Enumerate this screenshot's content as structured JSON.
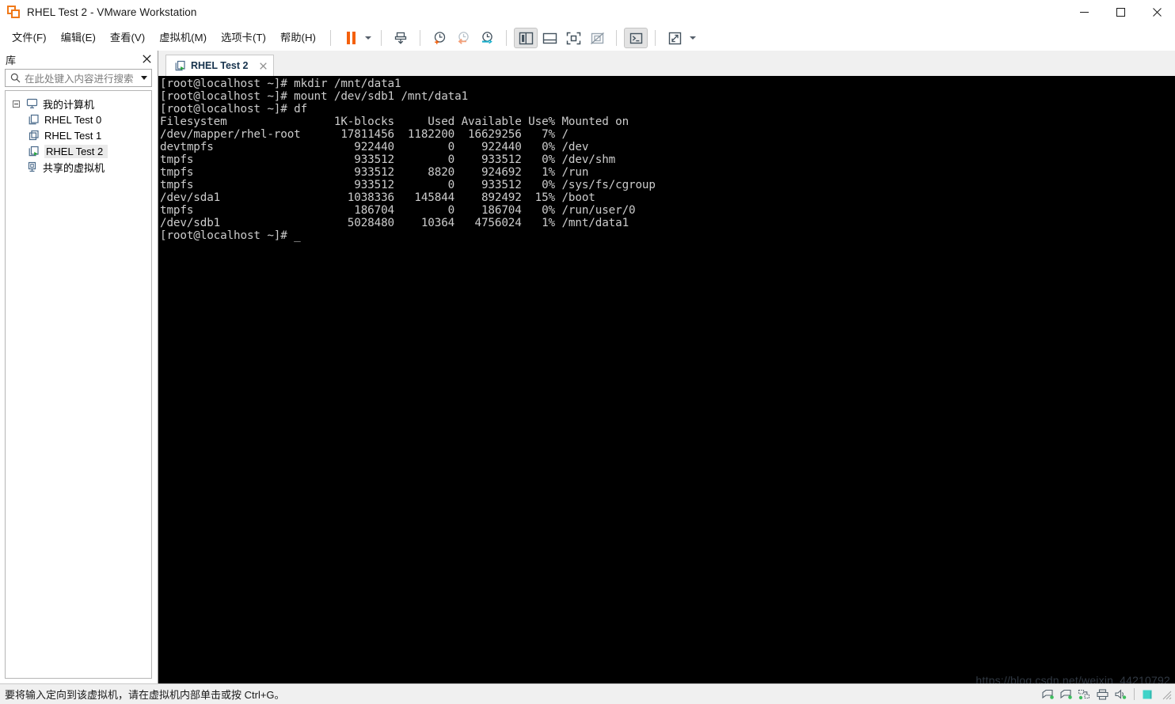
{
  "window": {
    "title": "RHEL Test 2 - VMware Workstation",
    "icon": "vmware-logo-icon",
    "controls": {
      "minimize": "minimize-button",
      "maximize": "maximize-button",
      "close": "close-button"
    }
  },
  "menubar": {
    "items": [
      {
        "label": "文件(F)",
        "name": "menu-file"
      },
      {
        "label": "编辑(E)",
        "name": "menu-edit"
      },
      {
        "label": "查看(V)",
        "name": "menu-view"
      },
      {
        "label": "虚拟机(M)",
        "name": "menu-vm"
      },
      {
        "label": "选项卡(T)",
        "name": "menu-tabs"
      },
      {
        "label": "帮助(H)",
        "name": "menu-help"
      }
    ]
  },
  "toolbar": {
    "buttons": [
      {
        "name": "suspend-button",
        "icon": "pause-icon"
      },
      {
        "name": "power-dropdown-button",
        "icon": "chevron-down-icon"
      },
      {
        "name": "manage-snapshots-button",
        "icon": "snapshot-manager-icon"
      },
      {
        "name": "take-snapshot-button",
        "icon": "snapshot-add-icon"
      },
      {
        "name": "revert-snapshot-button",
        "icon": "snapshot-revert-icon"
      },
      {
        "name": "snapshot-manager-button",
        "icon": "snapshot-settings-icon"
      },
      {
        "name": "show-library-button",
        "icon": "layout-sidebar-icon"
      },
      {
        "name": "show-thumbnail-bar-button",
        "icon": "layout-bottom-icon"
      },
      {
        "name": "fit-guest-button",
        "icon": "fit-window-icon"
      },
      {
        "name": "fit-guest-now-button",
        "icon": "fit-disabled-icon"
      },
      {
        "name": "console-view-button",
        "icon": "console-icon"
      },
      {
        "name": "fullscreen-button",
        "icon": "expand-arrows-icon"
      },
      {
        "name": "fullscreen-dropdown-button",
        "icon": "chevron-down-icon"
      }
    ]
  },
  "sidebar": {
    "title": "库",
    "close_icon": "close-icon",
    "search": {
      "placeholder": "在此处键入内容进行搜索",
      "value": "",
      "icon": "search-icon",
      "dropdown_icon": "chevron-down-icon"
    },
    "tree": [
      {
        "label": "我的计算机",
        "name": "tree-item-my-computer",
        "level": 0,
        "icon": "monitor-icon",
        "expanded": true,
        "selected": false
      },
      {
        "label": "RHEL Test 0",
        "name": "tree-item-rhel-test-0",
        "level": 1,
        "icon": "vm-icon",
        "selected": false
      },
      {
        "label": "RHEL Test 1",
        "name": "tree-item-rhel-test-1",
        "level": 1,
        "icon": "vm-stack-icon",
        "selected": false
      },
      {
        "label": "RHEL Test 2",
        "name": "tree-item-rhel-test-2",
        "level": 1,
        "icon": "vm-running-icon",
        "selected": true
      },
      {
        "label": "共享的虚拟机",
        "name": "tree-item-shared-vms",
        "level": 0,
        "icon": "shared-vm-icon",
        "expanded": false,
        "selected": false
      }
    ]
  },
  "tabs": [
    {
      "label": "RHEL Test 2",
      "name": "tab-rhel-test-2",
      "active": true,
      "icon": "vm-running-icon",
      "close_icon": "close-icon"
    }
  ],
  "terminal": {
    "lines": [
      "[root@localhost ~]# mkdir /mnt/data1",
      "[root@localhost ~]# mount /dev/sdb1 /mnt/data1",
      "[root@localhost ~]# df",
      "Filesystem                1K-blocks     Used Available Use% Mounted on",
      "/dev/mapper/rhel-root      17811456  1182200  16629256   7% /",
      "devtmpfs                     922440        0    922440   0% /dev",
      "tmpfs                        933512        0    933512   0% /dev/shm",
      "tmpfs                        933512     8820    924692   1% /run",
      "tmpfs                        933512        0    933512   0% /sys/fs/cgroup",
      "/dev/sda1                   1038336   145844    892492  15% /boot",
      "tmpfs                        186704        0    186704   0% /run/user/0",
      "/dev/sdb1                   5028480    10364   4756024   1% /mnt/data1",
      "[root@localhost ~]# _"
    ],
    "background": "#000000",
    "foreground": "#cccccc"
  },
  "statusbar": {
    "message": "要将输入定向到该虚拟机，请在虚拟机内部单击或按 Ctrl+G。",
    "icons": [
      {
        "name": "status-hard-disk-1-icon",
        "icon": "hard-disk-icon"
      },
      {
        "name": "status-hard-disk-2-icon",
        "icon": "hard-disk-icon"
      },
      {
        "name": "status-network-adapter-icon",
        "icon": "network-icon"
      },
      {
        "name": "status-printer-icon",
        "icon": "printer-icon"
      },
      {
        "name": "status-sound-card-icon",
        "icon": "sound-icon"
      },
      {
        "name": "status-display-icon",
        "icon": "display-icon"
      }
    ]
  },
  "watermark": {
    "text": "https://blog.csdn.net/weixin_44210792"
  },
  "colors": {
    "accent_orange": "#f4600c",
    "icon_slate": "#43525e",
    "terminal_bg": "#000000",
    "terminal_fg": "#cccccc",
    "chrome_bg": "#f0f0f0",
    "tab_text": "#17334d"
  }
}
